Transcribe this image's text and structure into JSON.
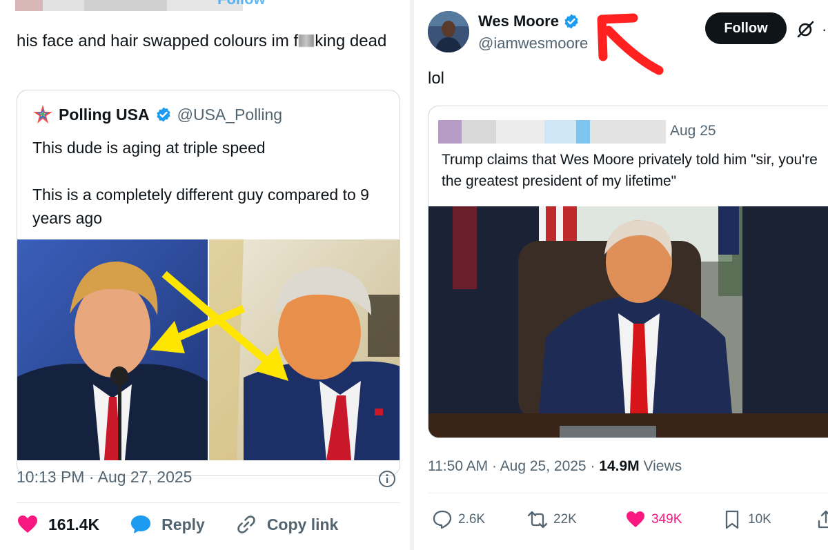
{
  "left_post": {
    "header_follow_label": "Follow",
    "text_before": "his face and hair swapped colours im f",
    "text_after": "king dead",
    "quoted": {
      "name": "Polling USA",
      "handle": "@USA_Polling",
      "text": "This dude is aging at triple speed\n\nThis is a completely different guy compared to 9 years ago"
    },
    "timestamp": "10:13 PM · Aug 27, 2025",
    "actions": {
      "likes": "161.4K",
      "reply_label": "Reply",
      "copy_label": "Copy link"
    }
  },
  "right_post": {
    "name": "Wes Moore",
    "handle": "@iamwesmoore",
    "follow_label": "Follow",
    "text": "lol",
    "quoted": {
      "date": "Aug 25",
      "text": "Trump claims that Wes Moore privately told him \"sir, you're the greatest president of my lifetime\""
    },
    "time": "11:50 AM · Aug 25, 2025 · ",
    "views_count": "14.9M",
    "views_label": " Views",
    "stats": {
      "replies": "2.6K",
      "reposts": "22K",
      "likes": "349K",
      "bookmarks": "10K"
    }
  },
  "colors": {
    "verified_blue": "#1d9bf0",
    "like_pink": "#f91880",
    "annotation_yellow": "#ffe600",
    "annotation_red": "#ff2020"
  },
  "icons": [
    "polling-logo-icon",
    "verified-icon",
    "info-icon",
    "heart-icon",
    "speech-bubble-icon",
    "link-icon",
    "grok-icon",
    "reply-icon",
    "repost-icon",
    "bookmark-icon",
    "share-icon"
  ]
}
